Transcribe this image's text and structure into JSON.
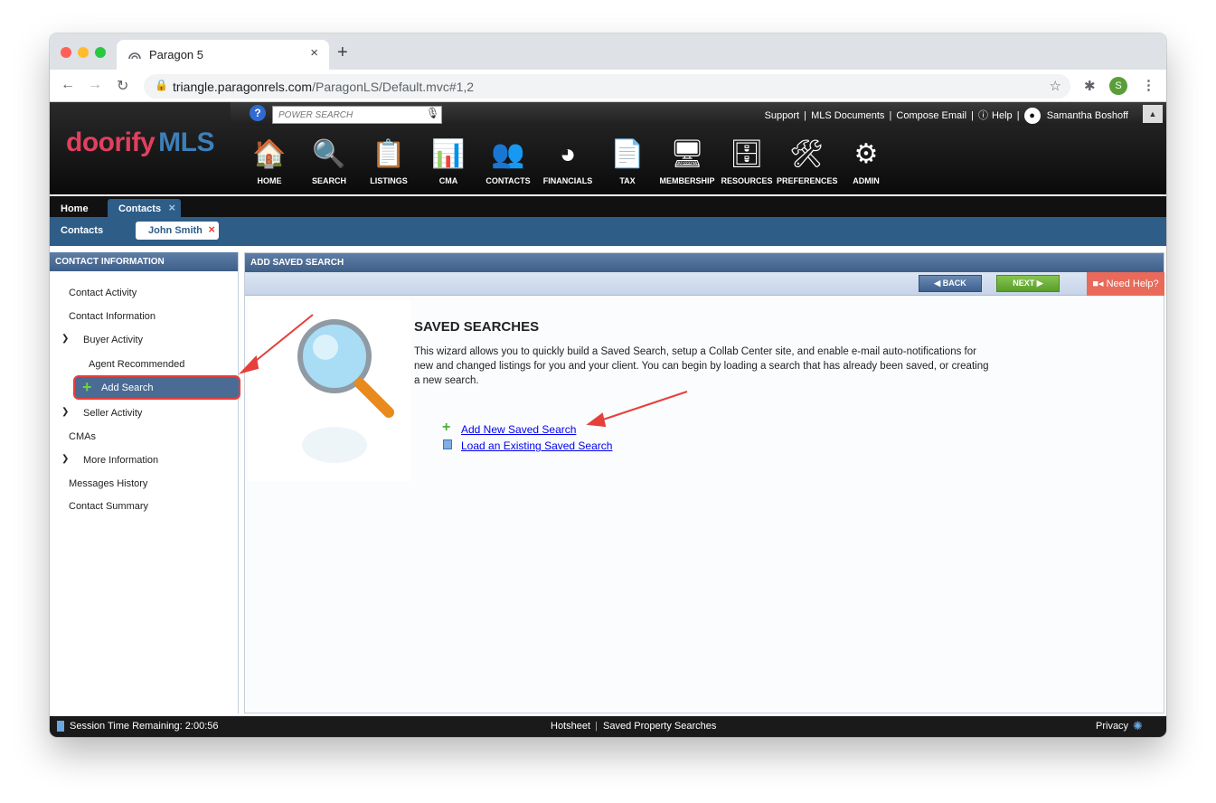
{
  "browser": {
    "tab_title": "Paragon 5",
    "tab_close": "×",
    "new_tab": "+",
    "url_host": "triangle.paragonrels.com",
    "url_path": "/ParagonLS/Default.mvc#1,2",
    "profile_initial": "S"
  },
  "header": {
    "power_search_placeholder": "POWER SEARCH",
    "help_q": "?",
    "links": [
      "Support",
      "MLS Documents",
      "Compose Email",
      "Help"
    ],
    "user_name": "Samantha Boshoff",
    "logo_brand": "doorify",
    "logo_mls": "MLS",
    "nav": [
      {
        "label": "HOME",
        "icon": "house-icon"
      },
      {
        "label": "SEARCH",
        "icon": "magnifier-doc-icon"
      },
      {
        "label": "LISTINGS",
        "icon": "listings-icon"
      },
      {
        "label": "CMA",
        "icon": "cma-icon"
      },
      {
        "label": "CONTACTS",
        "icon": "contacts-icon"
      },
      {
        "label": "FINANCIALS",
        "icon": "pie-chart-icon"
      },
      {
        "label": "TAX",
        "icon": "tax-icon"
      },
      {
        "label": "MEMBERSHIP",
        "icon": "membership-icon"
      },
      {
        "label": "RESOURCES",
        "icon": "resources-icon"
      },
      {
        "label": "PREFERENCES",
        "icon": "tools-icon"
      },
      {
        "label": "ADMIN",
        "icon": "admin-icon"
      }
    ]
  },
  "tabs": {
    "home": "Home",
    "contacts": "Contacts",
    "close": "×"
  },
  "subtabs": {
    "contacts": "Contacts",
    "contact": "John Smith",
    "close": "×"
  },
  "left": {
    "title": "CONTACT INFORMATION",
    "items": [
      "Contact Activity",
      "Contact Information",
      "Buyer Activity",
      "Agent Recommended",
      "Add Search",
      "Seller Activity",
      "CMAs",
      "More Information",
      "Messages History",
      "Contact Summary"
    ]
  },
  "main": {
    "title": "ADD SAVED SEARCH",
    "back": "BACK",
    "next": "NEXT",
    "need_help": "Need Help?",
    "heading": "SAVED SEARCHES",
    "description": "This wizard allows you to quickly build a Saved Search, setup a Collab Center site, and enable e-mail auto-notifications for new and changed listings for you and your client. You can begin by loading a search that has already been saved, or creating a new search.",
    "link_add": "Add New Saved Search",
    "link_load": "Load an Existing Saved Search"
  },
  "footer": {
    "session": "Session Time Remaining: 2:00:56",
    "hotsheet": "Hotsheet",
    "saved": "Saved Property Searches",
    "privacy": "Privacy"
  },
  "colors": {
    "accent_red": "#e5403b",
    "link_blue": "#0000ee",
    "header_blue": "#2e5d88",
    "next_green": "#6fb33b"
  }
}
